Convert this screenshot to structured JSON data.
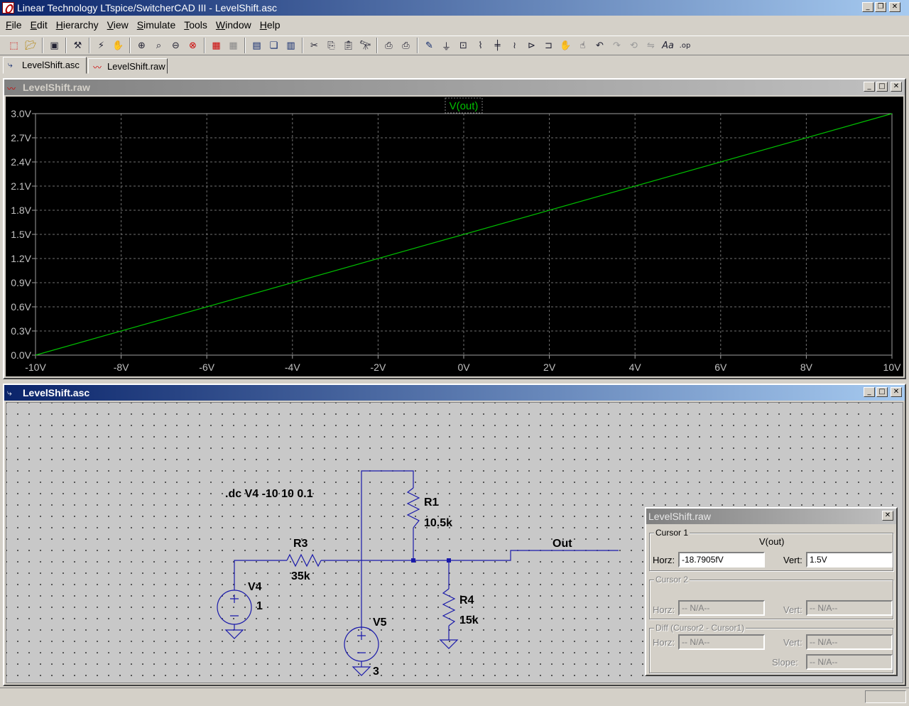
{
  "app": {
    "title": "Linear Technology LTspice/SwitcherCAD III - LevelShift.asc"
  },
  "menu": [
    {
      "label": "File",
      "key": "F",
      "rest": "ile"
    },
    {
      "label": "Edit",
      "key": "E",
      "rest": "dit"
    },
    {
      "label": "Hierarchy",
      "key": "H",
      "rest": "ierarchy"
    },
    {
      "label": "View",
      "key": "V",
      "rest": "iew"
    },
    {
      "label": "Simulate",
      "key": "S",
      "rest": "imulate"
    },
    {
      "label": "Tools",
      "key": "T",
      "rest": "ools"
    },
    {
      "label": "Window",
      "key": "W",
      "rest": "indow"
    },
    {
      "label": "Help",
      "key": "H",
      "rest": "elp"
    }
  ],
  "tabs": [
    {
      "label": "LevelShift.asc",
      "active": true
    },
    {
      "label": "LevelShift.raw",
      "active": false
    }
  ],
  "waveform_window": {
    "title": "LevelShift.raw"
  },
  "schematic_window": {
    "title": "LevelShift.asc"
  },
  "chart_data": {
    "type": "line",
    "title": "",
    "xlabel": "",
    "ylabel": "",
    "xlim": [
      -10,
      10
    ],
    "ylim": [
      0.0,
      3.0
    ],
    "x_ticks": [
      "-10V",
      "-8V",
      "-6V",
      "-4V",
      "-2V",
      "0V",
      "2V",
      "4V",
      "6V",
      "8V",
      "10V"
    ],
    "y_ticks": [
      "3.0V",
      "2.7V",
      "2.4V",
      "2.1V",
      "1.8V",
      "1.5V",
      "1.2V",
      "0.9V",
      "0.6V",
      "0.3V",
      "0.0V"
    ],
    "grid": true,
    "series": [
      {
        "name": "V(out)",
        "color": "#00c000",
        "x": [
          -10,
          10
        ],
        "y": [
          0.0,
          3.0
        ]
      }
    ]
  },
  "schematic": {
    "directive": ".dc V4 -10 10 0.1",
    "components": {
      "r1": {
        "name": "R1",
        "value": "10.5k"
      },
      "r3": {
        "name": "R3",
        "value": "35k"
      },
      "r4": {
        "name": "R4",
        "value": "15k"
      },
      "v4": {
        "name": "V4",
        "value": "1"
      },
      "v5": {
        "name": "V5",
        "value": "3"
      }
    },
    "net_label": "Out",
    "wire_color": "#1a1aaa"
  },
  "cursor_panel": {
    "title": "LevelShift.raw",
    "cursor1": {
      "label": "Cursor 1",
      "trace": "V(out)",
      "horz_label": "Horz:",
      "horz": "-18.7905fV",
      "vert_label": "Vert:",
      "vert": "1.5V"
    },
    "cursor2": {
      "label": "Cursor 2",
      "horz_label": "Horz:",
      "horz": "-- N/A--",
      "vert_label": "Vert:",
      "vert": "-- N/A--"
    },
    "diff": {
      "label": "Diff (Cursor2 - Cursor1)",
      "horz_label": "Horz:",
      "horz": "-- N/A--",
      "vert_label": "Vert:",
      "vert": "-- N/A--",
      "slope_label": "Slope:",
      "slope": "-- N/A--"
    }
  }
}
